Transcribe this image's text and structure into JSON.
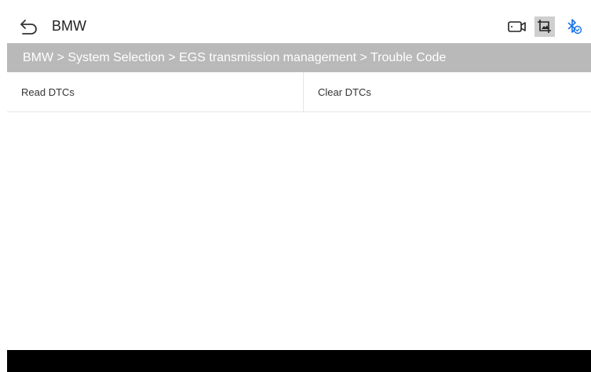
{
  "header": {
    "title": "BMW",
    "icons": [
      "back-icon",
      "video-record-icon",
      "screenshot-crop-icon",
      "bluetooth-connected-icon"
    ],
    "bluetooth_color": "#1a73e8"
  },
  "breadcrumb": {
    "text": "BMW > System Selection > EGS transmission management > Trouble Code",
    "background": "#b9b9b9"
  },
  "functions": {
    "read": "Read DTCs",
    "clear": "Clear DTCs"
  }
}
